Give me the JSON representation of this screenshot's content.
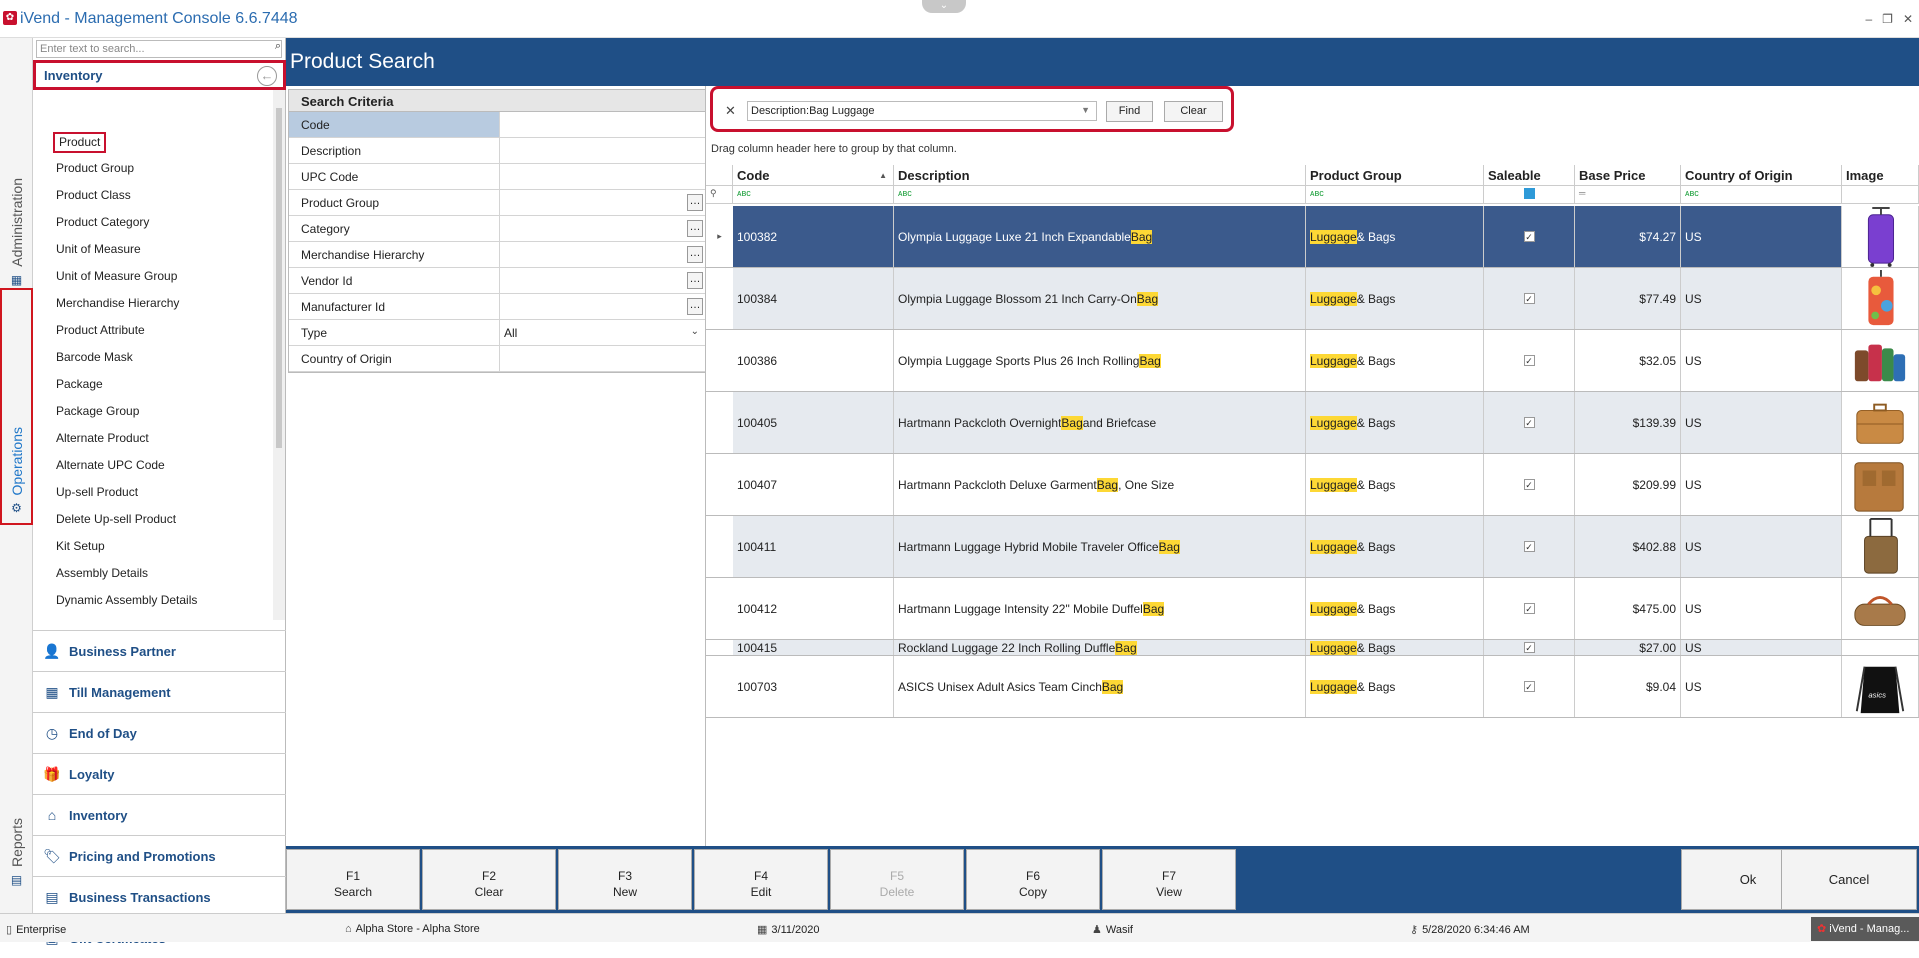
{
  "window": {
    "title": "iVend - Management Console  6.6.7448",
    "top_tab_glyph": "⌄",
    "controls": [
      "–",
      "❐",
      "✕"
    ]
  },
  "vtabs": {
    "administration": "Administration",
    "operations": "Operations",
    "reports": "Reports"
  },
  "nav": {
    "search_placeholder": "Enter text to search...",
    "header": "Inventory",
    "items": [
      "Product",
      "Product Group",
      "Product Class",
      "Product Category",
      "Unit of Measure",
      "Unit of Measure Group",
      "Merchandise Hierarchy",
      "Product Attribute",
      "Barcode Mask",
      "Package",
      "Package Group",
      "Alternate Product",
      "Alternate UPC Code",
      "Up-sell Product",
      "Delete Up-sell Product",
      "Kit Setup",
      "Assembly Details",
      "Dynamic Assembly Details"
    ],
    "groups": [
      "Business Partner",
      "Till Management",
      "End of Day",
      "Loyalty",
      "Inventory",
      "Pricing and Promotions",
      "Business Transactions",
      "Gift Certificates"
    ]
  },
  "main": {
    "title": "Product Search"
  },
  "criteria": {
    "title": "Search Criteria",
    "rows": [
      {
        "label": "Code",
        "value": ""
      },
      {
        "label": "Description",
        "value": ""
      },
      {
        "label": "UPC Code",
        "value": ""
      },
      {
        "label": "Product Group",
        "value": ""
      },
      {
        "label": "Category",
        "value": ""
      },
      {
        "label": "Merchandise Hierarchy",
        "value": ""
      },
      {
        "label": "Vendor Id",
        "value": ""
      },
      {
        "label": "Manufacturer Id",
        "value": ""
      },
      {
        "label": "Type",
        "value": "All"
      },
      {
        "label": "Country of Origin",
        "value": ""
      }
    ]
  },
  "find": {
    "value": "Description:Bag Luggage",
    "find_label": "Find",
    "clear_label": "Clear"
  },
  "grid": {
    "group_hint": "Drag column header here to group by that column.",
    "columns": [
      "Code",
      "Description",
      "Product Group",
      "Saleable",
      "Base Price",
      "Country of Origin",
      "Image"
    ],
    "filter_glyph": "ᴀʙᴄ",
    "rows": [
      {
        "code": "100382",
        "desc_pre": "Olympia Luggage Luxe 21 Inch Expandable ",
        "desc_hl": "Bag",
        "desc_post": "",
        "group_hl": "Luggage",
        "group_post": " & Bags",
        "saleable": true,
        "price": "$74.27",
        "country": "US",
        "image": "purple-suitcase"
      },
      {
        "code": "100384",
        "desc_pre": "Olympia Luggage Blossom 21 Inch Carry-On ",
        "desc_hl": "Bag",
        "desc_post": "",
        "group_hl": "Luggage",
        "group_post": " & Bags",
        "saleable": true,
        "price": "$77.49",
        "country": "US",
        "image": "floral-suitcase"
      },
      {
        "code": "100386",
        "desc_pre": "Olympia Luggage Sports Plus 26 Inch Rolling ",
        "desc_hl": "Bag",
        "desc_post": "",
        "group_hl": "Luggage",
        "group_post": " & Bags",
        "saleable": true,
        "price": "$32.05",
        "country": "US",
        "image": "luggage-set"
      },
      {
        "code": "100405",
        "desc_pre": "Hartmann Packcloth Overnight ",
        "desc_hl": "Bag",
        "desc_post": " and Briefcase",
        "group_hl": "Luggage",
        "group_post": " & Bags",
        "saleable": true,
        "price": "$139.39",
        "country": "US",
        "image": "briefcase"
      },
      {
        "code": "100407",
        "desc_pre": "Hartmann Packcloth Deluxe Garment ",
        "desc_hl": "Bag",
        "desc_post": ", One Size",
        "group_hl": "Luggage",
        "group_post": " & Bags",
        "saleable": true,
        "price": "$209.99",
        "country": "US",
        "image": "garment-bag"
      },
      {
        "code": "100411",
        "desc_pre": "Hartmann Luggage Hybrid Mobile Traveler Office ",
        "desc_hl": "Bag",
        "desc_post": "",
        "group_hl": "Luggage",
        "group_post": " & Bags",
        "saleable": true,
        "price": "$402.88",
        "country": "US",
        "image": "rolling-office-bag"
      },
      {
        "code": "100412",
        "desc_pre": "Hartmann Luggage Intensity 22\" Mobile  Duffel ",
        "desc_hl": "Bag",
        "desc_post": "",
        "group_hl": "Luggage",
        "group_post": " & Bags",
        "saleable": true,
        "price": "$475.00",
        "country": "US",
        "image": "duffel"
      },
      {
        "code": "100415",
        "desc_pre": "Rockland Luggage 22 Inch Rolling Duffle ",
        "desc_hl": "Bag",
        "desc_post": "",
        "group_hl": "Luggage",
        "group_post": " & Bags",
        "saleable": true,
        "price": "$27.00",
        "country": "US",
        "image": ""
      },
      {
        "code": "100703",
        "desc_pre": "ASICS Unisex Adult Asics Team Cinch ",
        "desc_hl": "Bag",
        "desc_post": "",
        "group_hl": "Luggage",
        "group_post": " & Bags",
        "saleable": true,
        "price": "$9.04",
        "country": "US",
        "image": "cinch-bag"
      }
    ]
  },
  "fkeys": [
    {
      "key": "F1",
      "label": "Search",
      "enabled": true
    },
    {
      "key": "F2",
      "label": "Clear",
      "enabled": true
    },
    {
      "key": "F3",
      "label": "New",
      "enabled": true
    },
    {
      "key": "F4",
      "label": "Edit",
      "enabled": true
    },
    {
      "key": "F5",
      "label": "Delete",
      "enabled": false
    },
    {
      "key": "F6",
      "label": "Copy",
      "enabled": true
    },
    {
      "key": "F7",
      "label": "View",
      "enabled": true
    }
  ],
  "actions": {
    "ok": "Ok",
    "cancel": "Cancel"
  },
  "status": {
    "edition": "Enterprise",
    "store": "Alpha Store - Alpha Store",
    "date": "3/11/2020",
    "user": "Wasif",
    "datetime": "5/28/2020 6:34:46 AM",
    "task": "iVend - Manag..."
  },
  "colors": {
    "brand": "#1f4f86",
    "highlight": "#fdd835",
    "annotation": "#c8102e",
    "selected_row": "#3b5a8c"
  }
}
